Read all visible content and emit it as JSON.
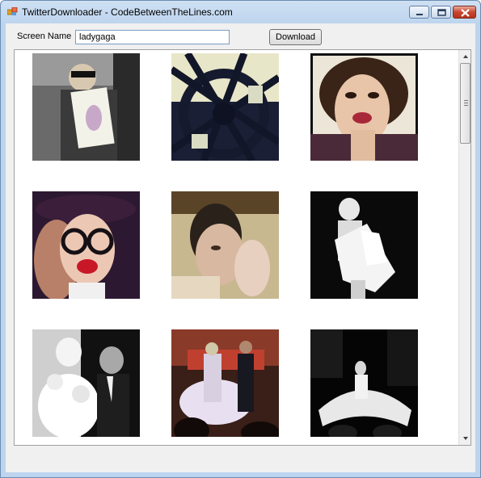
{
  "window": {
    "title": "TwitterDownloader - CodeBetweenTheLines.com"
  },
  "form": {
    "screen_name_label": "Screen Name",
    "screen_name_value": "ladygaga",
    "download_label": "Download"
  },
  "thumbnails": [
    {
      "icon": "photo-reading-book"
    },
    {
      "icon": "photo-ferris-wheel"
    },
    {
      "icon": "photo-selfie-red-lips"
    },
    {
      "icon": "photo-hat-glasses"
    },
    {
      "icon": "photo-face-closeup"
    },
    {
      "icon": "photo-white-dress-bw"
    },
    {
      "icon": "photo-duet-bw"
    },
    {
      "icon": "photo-stage-performance"
    },
    {
      "icon": "photo-stage-dark"
    }
  ],
  "colors": {
    "title_bar": "#bcd4ee",
    "close_button": "#c7462f",
    "panel_bg": "#ffffff"
  }
}
